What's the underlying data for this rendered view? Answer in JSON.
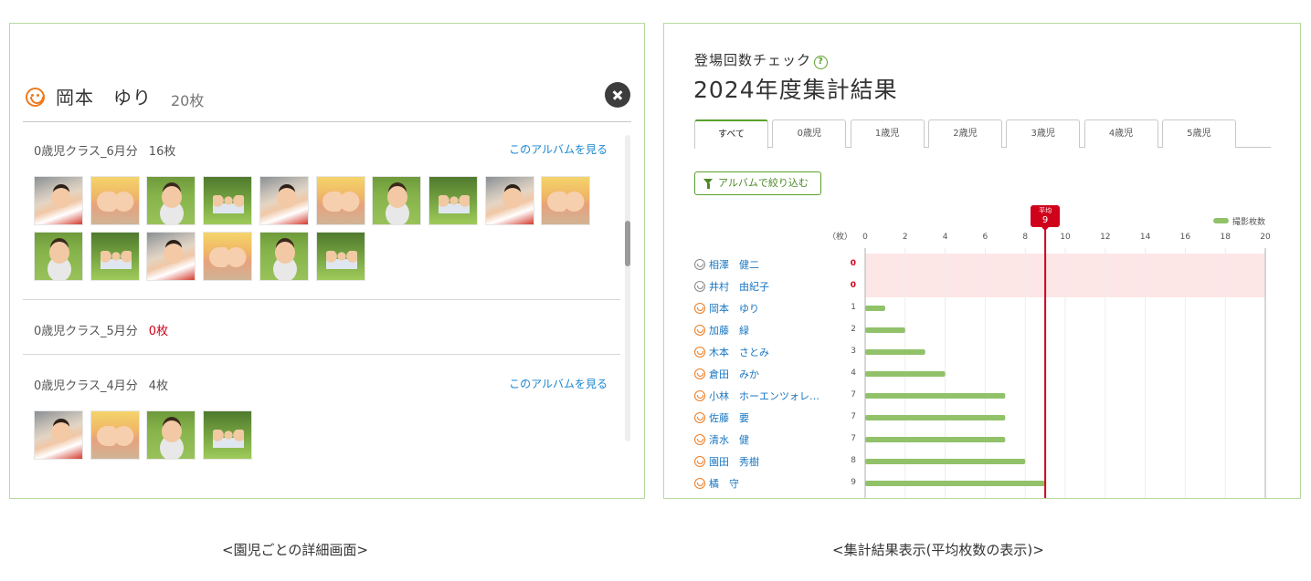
{
  "detail": {
    "child_name": "岡本　ゆり",
    "photo_count": "20枚",
    "albums": [
      {
        "title": "0歳児クラス_6月分",
        "count": "16枚",
        "link": "このアルバムを見る",
        "thumbs": [
          "t1",
          "t2",
          "t3",
          "t4",
          "t1",
          "t2",
          "t3",
          "t4",
          "t1",
          "t2",
          "t3",
          "t4",
          "t1",
          "t2",
          "t3",
          "t4"
        ]
      },
      {
        "title": "0歳児クラス_5月分",
        "count": "0枚",
        "link": "",
        "thumbs": []
      },
      {
        "title": "0歳児クラス_4月分",
        "count": "4枚",
        "link": "このアルバムを見る",
        "thumbs": [
          "t1",
          "t2",
          "t3",
          "t4"
        ]
      }
    ]
  },
  "summary": {
    "check_title": "登場回数チェック",
    "result_title": "2024年度集計結果",
    "tabs": [
      "すべて",
      "0歳児",
      "1歳児",
      "2歳児",
      "3歳児",
      "4歳児",
      "5歳児"
    ],
    "active_tab": "すべて",
    "filter_button": "アルバムで絞り込む",
    "legend": "撮影枚数",
    "avg_label": "平均",
    "unit_label": "（枚）"
  },
  "chart_data": {
    "type": "bar",
    "orientation": "horizontal",
    "xlim": [
      0,
      20
    ],
    "ticks": [
      0,
      2,
      4,
      6,
      8,
      10,
      12,
      14,
      16,
      18,
      20
    ],
    "xlabel": "（枚）",
    "average": 9,
    "series": [
      {
        "name": "撮影枚数",
        "color": "#91c26a"
      }
    ],
    "rows": [
      {
        "name": "相澤　健二",
        "value": 0,
        "face": "neutral"
      },
      {
        "name": "井村　由紀子",
        "value": 0,
        "face": "neutral"
      },
      {
        "name": "岡本　ゆり",
        "value": 1,
        "face": "smile"
      },
      {
        "name": "加藤　緑",
        "value": 2,
        "face": "smile"
      },
      {
        "name": "木本　さとみ",
        "value": 3,
        "face": "smile"
      },
      {
        "name": "倉田　みか",
        "value": 4,
        "face": "smile"
      },
      {
        "name": "小林　ホーエンツォレ…",
        "value": 7,
        "face": "smile"
      },
      {
        "name": "佐藤　要",
        "value": 7,
        "face": "smile"
      },
      {
        "name": "清水　健",
        "value": 7,
        "face": "smile"
      },
      {
        "name": "園田　秀樹",
        "value": 8,
        "face": "smile"
      },
      {
        "name": "橘　守",
        "value": 9,
        "face": "smile"
      }
    ],
    "colors": {
      "bar": "#91c26a",
      "average_line": "#d0021b",
      "zero_highlight": "#fde6e6",
      "zero_text": "#d0021b"
    }
  },
  "captions": {
    "left": "<園児ごとの詳細画面>",
    "right": "<集計結果表示(平均枚数の表示)>"
  }
}
